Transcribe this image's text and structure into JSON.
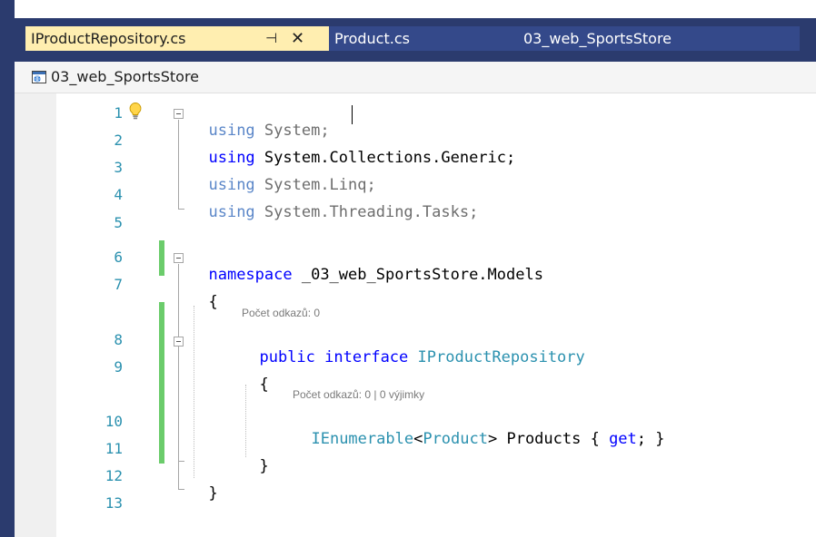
{
  "tabs": {
    "active": {
      "label": "IProductRepository.cs",
      "pin": "⊣",
      "close": "✕"
    },
    "second": {
      "label": "Product.cs"
    },
    "third": {
      "label": "03_web_SportsStore"
    }
  },
  "navbar": {
    "project": "03_web_SportsStore"
  },
  "code": {
    "line_numbers": [
      "1",
      "2",
      "3",
      "4",
      "5",
      "6",
      "7",
      "8",
      "9",
      "10",
      "11",
      "12",
      "13"
    ],
    "l1_kw": "using",
    "l1_rest": " System;",
    "l2_kw": "using",
    "l2_rest": " System.Collections.Generic;",
    "l3_kw": "using",
    "l3_rest": " System.Linq;",
    "l4_kw": "using",
    "l4_rest": " System.Threading.Tasks;",
    "l6_kw": "namespace",
    "l6_rest": " _03_web_SportsStore.Models",
    "l7": "{",
    "lens_interface": "Počet odkazů: 0",
    "l8_kw1": "public",
    "l8_kw2": "interface",
    "l8_type": "IProductRepository",
    "l9": "{",
    "lens_member": "Počet odkazů: 0 | 0 výjimky",
    "l10_type1": "IEnumerable",
    "l10_lt": "<",
    "l10_type2": "Product",
    "l10_gt": ">",
    "l10_name": " Products { ",
    "l10_kw": "get",
    "l10_end": "; }",
    "l11": "}",
    "l12": "}"
  },
  "colors": {
    "tabbar": "#2b3b6e",
    "active_tab": "#ffeeb0",
    "line_number": "#2b91af",
    "keyword": "#0000ff",
    "type": "#2b91af",
    "change_bar": "#6bcc6b"
  }
}
